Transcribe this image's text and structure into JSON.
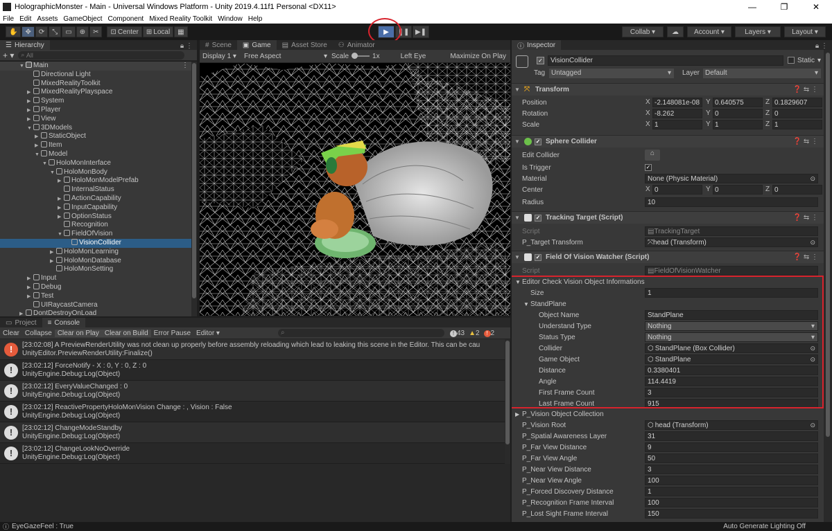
{
  "window": {
    "title": "HolographicMonster - Main - Universal Windows Platform - Unity 2019.4.11f1 Personal <DX11>",
    "controls": [
      "—",
      "❐",
      "✕"
    ]
  },
  "menu": [
    "File",
    "Edit",
    "Assets",
    "GameObject",
    "Component",
    "Mixed Reality Toolkit",
    "Window",
    "Help"
  ],
  "toolbar": {
    "center_label": "Center",
    "local_label": "Local",
    "collab_label": "Collab ▾",
    "account_label": "Account",
    "layers_label": "Layers",
    "layout_label": "Layout",
    "play_icon": "play-icon",
    "pause_icon": "pause-icon",
    "step_icon": "step-icon"
  },
  "hierarchy": {
    "tab_label": "Hierarchy",
    "search_placeholder": "All",
    "scene_name": "Main",
    "items": [
      {
        "label": "Directional Light",
        "depth": 1,
        "arrow": ""
      },
      {
        "label": "MixedRealityToolkit",
        "depth": 1,
        "arrow": ""
      },
      {
        "label": "MixedRealityPlayspace",
        "depth": 1,
        "arrow": "▶"
      },
      {
        "label": "System",
        "depth": 1,
        "arrow": "▶"
      },
      {
        "label": "Player",
        "depth": 1,
        "arrow": "▶"
      },
      {
        "label": "View",
        "depth": 1,
        "arrow": "▶"
      },
      {
        "label": "3DModels",
        "depth": 1,
        "arrow": "▼"
      },
      {
        "label": "StaticObject",
        "depth": 2,
        "arrow": "▶"
      },
      {
        "label": "Item",
        "depth": 2,
        "arrow": "▶"
      },
      {
        "label": "Model",
        "depth": 2,
        "arrow": "▼"
      },
      {
        "label": "HoloMonInterface",
        "depth": 3,
        "arrow": "▼"
      },
      {
        "label": "HoloMonBody",
        "depth": 4,
        "arrow": "▼"
      },
      {
        "label": "HoloMonModelPrefab",
        "depth": 5,
        "arrow": "▶"
      },
      {
        "label": "InternalStatus",
        "depth": 5,
        "arrow": ""
      },
      {
        "label": "ActionCapability",
        "depth": 5,
        "arrow": "▶"
      },
      {
        "label": "InputCapability",
        "depth": 5,
        "arrow": "▶"
      },
      {
        "label": "OptionStatus",
        "depth": 5,
        "arrow": "▶"
      },
      {
        "label": "Recognition",
        "depth": 5,
        "arrow": ""
      },
      {
        "label": "FieldOfVision",
        "depth": 5,
        "arrow": "▼"
      },
      {
        "label": "VisionCollider",
        "depth": 6,
        "arrow": "",
        "selected": true
      },
      {
        "label": "HoloMonLearning",
        "depth": 4,
        "arrow": "▶"
      },
      {
        "label": "HoloMonDatabase",
        "depth": 4,
        "arrow": "▶"
      },
      {
        "label": "HoloMonSetting",
        "depth": 4,
        "arrow": ""
      },
      {
        "label": "Input",
        "depth": 1,
        "arrow": "▶"
      },
      {
        "label": "Debug",
        "depth": 1,
        "arrow": "▶"
      },
      {
        "label": "Test",
        "depth": 1,
        "arrow": "▶"
      },
      {
        "label": "UIRaycastCamera",
        "depth": 1,
        "arrow": ""
      },
      {
        "label": "DontDestroyOnLoad",
        "depth": 0,
        "arrow": "▶"
      }
    ]
  },
  "game_view": {
    "tabs": [
      "Scene",
      "Game",
      "Asset Store",
      "Animator"
    ],
    "display": "Display 1",
    "aspect": "Free Aspect",
    "scale_label": "Scale",
    "scale_value": "1x",
    "eye": "Left Eye",
    "maximize": "Maximize On Play"
  },
  "console": {
    "tabs": [
      "Project",
      "Console"
    ],
    "buttons": [
      "Clear",
      "Collapse",
      "Clear on Play",
      "Clear on Build",
      "Error Pause",
      "Editor ▾"
    ],
    "counts": {
      "info": "43",
      "warn": "2",
      "error": "2"
    },
    "entries": [
      {
        "type": "error",
        "line1": "[23:02:08] A PreviewRenderUtility was not clean up properly before assembly reloading which lead to leaking this scene in the Editor. This can be cau",
        "line2": "UnityEditor.PreviewRenderUtility:Finalize()"
      },
      {
        "type": "info",
        "line1": "[23:02:12] ForceNotify - X : 0, Y : 0, Z : 0",
        "line2": "UnityEngine.Debug:Log(Object)"
      },
      {
        "type": "info",
        "line1": "[23:02:12] EveryValueChanged : 0",
        "line2": "UnityEngine.Debug:Log(Object)"
      },
      {
        "type": "info",
        "line1": "[23:02:12] ReactivePropertyHoloMonVision Change : , Vision : False",
        "line2": "UnityEngine.Debug:Log(Object)"
      },
      {
        "type": "info",
        "line1": "[23:02:12] ChangeModeStandby",
        "line2": "UnityEngine.Debug:Log(Object)"
      },
      {
        "type": "info",
        "line1": "[23:02:12] ChangeLookNoOverride",
        "line2": "UnityEngine.Debug:Log(Object)"
      }
    ]
  },
  "inspector": {
    "tab_label": "Inspector",
    "object_name": "VisionCollider",
    "static_label": "Static",
    "tag_label": "Tag",
    "tag_value": "Untagged",
    "layer_label": "Layer",
    "layer_value": "Default",
    "transform": {
      "title": "Transform",
      "position_label": "Position",
      "px": "-2.148081e-08",
      "py": "0.640575",
      "pz": "0.1829607",
      "rotation_label": "Rotation",
      "rx": "-8.262",
      "ry": "0",
      "rz": "0",
      "scale_label": "Scale",
      "sx": "1",
      "sy": "1",
      "sz": "1"
    },
    "sphere": {
      "title": "Sphere Collider",
      "edit_label": "Edit Collider",
      "trigger_label": "Is Trigger",
      "material_label": "Material",
      "material_value": "None (Physic Material)",
      "center_label": "Center",
      "cx": "0",
      "cy": "0",
      "cz": "0",
      "radius_label": "Radius",
      "radius_value": "10"
    },
    "tracking": {
      "title": "Tracking Target (Script)",
      "script_label": "Script",
      "script_value": "TrackingTarget",
      "target_label": "P_Target Transform",
      "target_value": "head (Transform)"
    },
    "fov": {
      "title": "Field Of Vision Watcher (Script)",
      "script_label": "Script",
      "script_value": "FieldOfVisionWatcher",
      "editor_check_label": "Editor Check Vision Object Informations",
      "size_label": "Size",
      "size_value": "1",
      "standplane_label": "StandPlane",
      "fields": [
        {
          "label": "Object Name",
          "value": "StandPlane",
          "kind": "text"
        },
        {
          "label": "Understand Type",
          "value": "Nothing",
          "kind": "dropdown"
        },
        {
          "label": "Status Type",
          "value": "Nothing",
          "kind": "dropdown"
        },
        {
          "label": "Collider",
          "value": "StandPlane (Box Collider)",
          "kind": "object"
        },
        {
          "label": "Game Object",
          "value": "StandPlane",
          "kind": "object"
        },
        {
          "label": "Distance",
          "value": "0.3380401",
          "kind": "text"
        },
        {
          "label": "Angle",
          "value": "114.4419",
          "kind": "text"
        },
        {
          "label": "First Frame Count",
          "value": "3",
          "kind": "text"
        },
        {
          "label": "Last Frame Count",
          "value": "915",
          "kind": "text"
        }
      ],
      "collection_label": "P_Vision Object Collection",
      "params": [
        {
          "label": "P_Vision Root",
          "value": "head (Transform)",
          "kind": "object"
        },
        {
          "label": "P_Spatial Awareness Layer",
          "value": "31",
          "kind": "text"
        },
        {
          "label": "P_Far View Distance",
          "value": "9",
          "kind": "text"
        },
        {
          "label": "P_Far View Angle",
          "value": "50",
          "kind": "text"
        },
        {
          "label": "P_Near View Distance",
          "value": "3",
          "kind": "text"
        },
        {
          "label": "P_Near View Angle",
          "value": "100",
          "kind": "text"
        },
        {
          "label": "P_Forced Discovery Distance",
          "value": "1",
          "kind": "text"
        },
        {
          "label": "P_Recognition Frame Interval",
          "value": "100",
          "kind": "text"
        },
        {
          "label": "P_Lost Sight Frame Interval",
          "value": "150",
          "kind": "text"
        }
      ]
    }
  },
  "status": {
    "left": "EyeGazeFeel : True",
    "right": "Auto Generate Lighting Off"
  },
  "colors": {
    "accent": "#2c5d87",
    "highlight": "#d8232d",
    "play_active": "#4b6ea8"
  }
}
